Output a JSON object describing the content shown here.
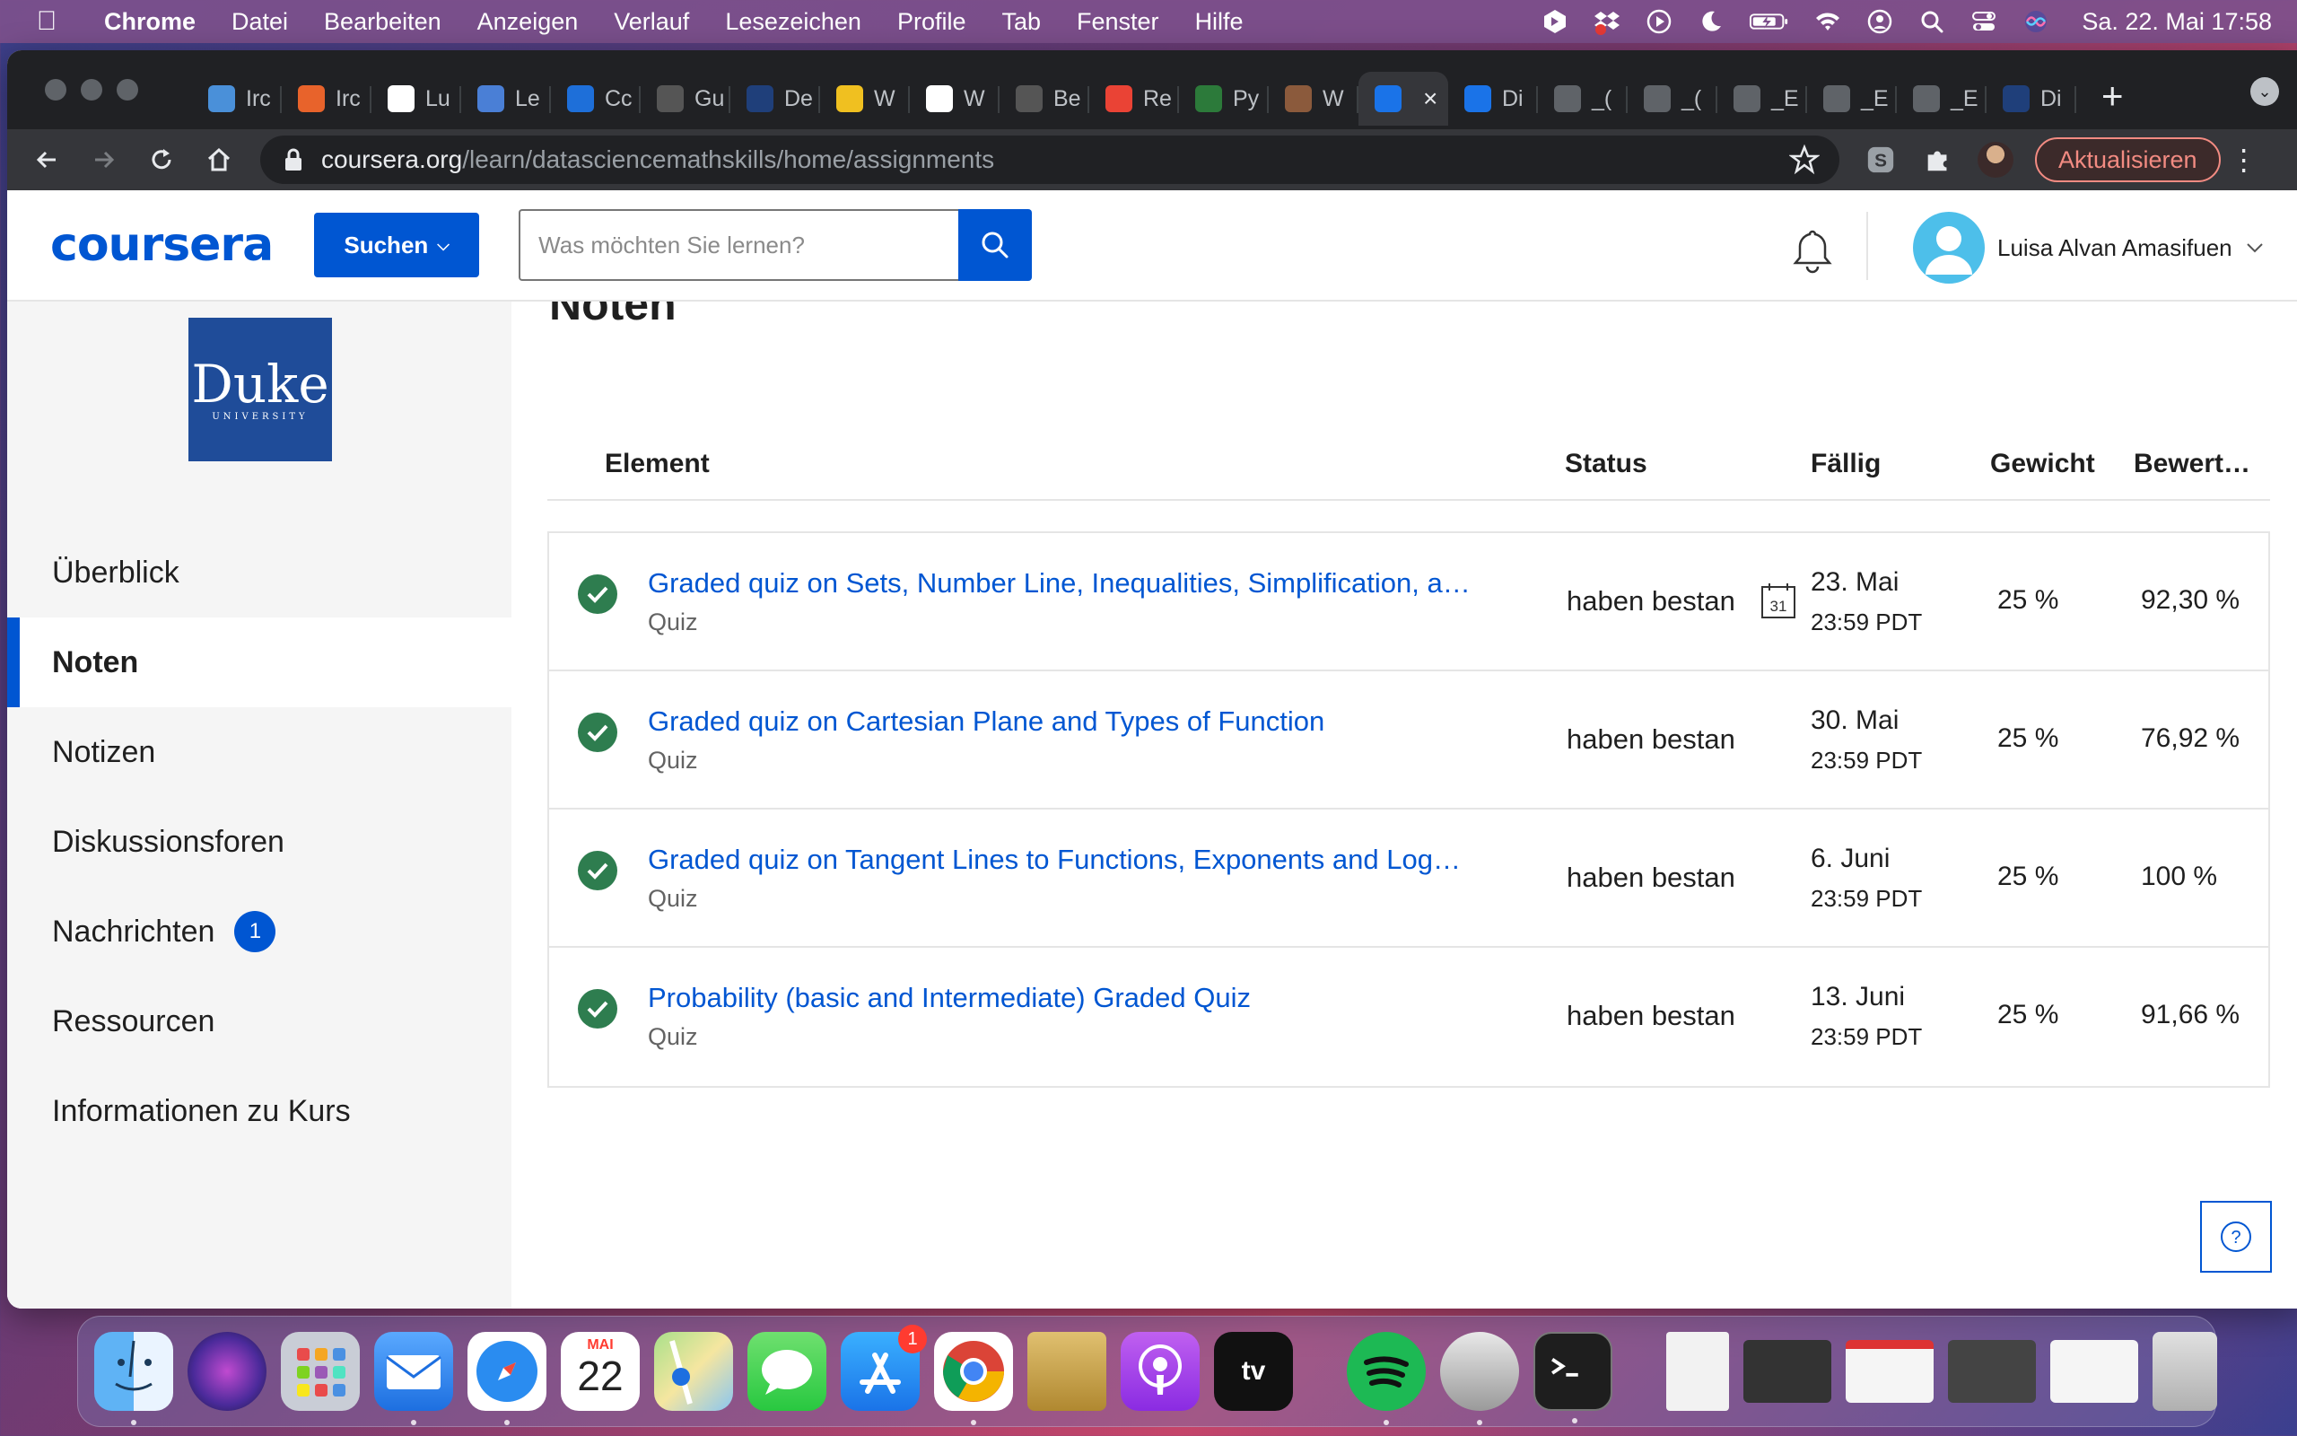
{
  "menubar": {
    "app_name": "Chrome",
    "items": [
      "Datei",
      "Bearbeiten",
      "Anzeigen",
      "Verlauf",
      "Lesezeichen",
      "Profile",
      "Tab",
      "Fenster",
      "Hilfe"
    ],
    "clock": "Sa. 22. Mai  17:58",
    "status_icons": [
      "vpn-icon",
      "dropbox-icon",
      "play-icon",
      "moon-icon",
      "battery-icon",
      "wifi-icon",
      "user-circle-icon",
      "spotlight-icon",
      "control-center-icon",
      "siri-icon"
    ]
  },
  "browser": {
    "tabs": [
      {
        "label": "Irc",
        "color": "#4a90d9"
      },
      {
        "label": "Irc",
        "color": "#e8632b"
      },
      {
        "label": "Lu",
        "color": "#ffffff"
      },
      {
        "label": "Le",
        "color": "#4a7fd6"
      },
      {
        "label": "Cc",
        "color": "#1e6fd9"
      },
      {
        "label": "Gu",
        "color": "#555555"
      },
      {
        "label": "De",
        "color": "#1f3f7a"
      },
      {
        "label": "W",
        "color": "#f0c020"
      },
      {
        "label": "W",
        "color": "#ffffff"
      },
      {
        "label": "Be",
        "color": "#555555"
      },
      {
        "label": "Re",
        "color": "#ea4335"
      },
      {
        "label": "Py",
        "color": "#2c7a3a"
      },
      {
        "label": "W",
        "color": "#8b5a3c"
      },
      {
        "label": "",
        "color": "#1a73e8",
        "active": true
      },
      {
        "label": "Di",
        "color": "#1a73e8"
      },
      {
        "label": "_(",
        "color": "#5f6368"
      },
      {
        "label": "_(",
        "color": "#5f6368"
      },
      {
        "label": "_E",
        "color": "#5f6368"
      },
      {
        "label": "_E",
        "color": "#5f6368"
      },
      {
        "label": "_E",
        "color": "#5f6368"
      },
      {
        "label": "Di",
        "color": "#1f3f7a"
      }
    ],
    "url_host": "coursera.org",
    "url_path": "/learn/datasciencemathskills/home/assignments",
    "update_label": "Aktualisieren"
  },
  "coursera": {
    "logo": "coursera",
    "explore_label": "Suchen",
    "search_placeholder": "Was möchten Sie lernen?",
    "user_name": "Luisa Alvan Amasifuen",
    "brand_color": "#0056d2"
  },
  "sidebar": {
    "logo_text": "Duke",
    "logo_subtext": "UNIVERSITY",
    "items": [
      {
        "label": "Überblick"
      },
      {
        "label": "Noten",
        "active": true
      },
      {
        "label": "Notizen"
      },
      {
        "label": "Diskussionsforen"
      },
      {
        "label": "Nachrichten",
        "badge": "1"
      },
      {
        "label": "Ressourcen"
      },
      {
        "label": "Informationen zu Kurs"
      }
    ]
  },
  "main": {
    "heading": "Noten",
    "columns": {
      "element": "Element",
      "status": "Status",
      "due": "Fällig",
      "weight": "Gewicht",
      "grade": "Bewert…"
    },
    "calendar_day": "31",
    "rows": [
      {
        "title": "Graded quiz on Sets, Number Line, Inequalities, Simplification, an…",
        "type": "Quiz",
        "status": "haben bestan",
        "due_date": "23. Mai",
        "due_time": "23:59 PDT",
        "weight": "25 %",
        "grade": "92,30 %",
        "show_calendar": true
      },
      {
        "title": "Graded quiz on Cartesian Plane and Types of Function",
        "type": "Quiz",
        "status": "haben bestan",
        "due_date": "30. Mai",
        "due_time": "23:59 PDT",
        "weight": "25 %",
        "grade": "76,92 %"
      },
      {
        "title": "Graded quiz on Tangent Lines to Functions, Exponents and Logarit…",
        "type": "Quiz",
        "status": "haben bestan",
        "due_date": "6. Juni",
        "due_time": "23:59 PDT",
        "weight": "25 %",
        "grade": "100 %"
      },
      {
        "title": "Probability (basic and Intermediate) Graded Quiz",
        "type": "Quiz",
        "status": "haben bestan",
        "due_date": "13. Juni",
        "due_time": "23:59 PDT",
        "weight": "25 %",
        "grade": "91,66 %"
      }
    ]
  },
  "dock": {
    "calendar_month": "MAI",
    "calendar_day": "22",
    "appstore_badge": "1",
    "apps": [
      "finder-icon",
      "siri-icon",
      "launchpad-icon",
      "mail-icon",
      "safari-icon",
      "calendar-icon",
      "maps-icon",
      "messages-icon",
      "app-store-icon",
      "chrome-icon",
      "archive-utility-icon",
      "podcasts-icon",
      "apple-tv-icon",
      "spotify-icon",
      "disk-utility-icon",
      "terminal-icon"
    ]
  }
}
